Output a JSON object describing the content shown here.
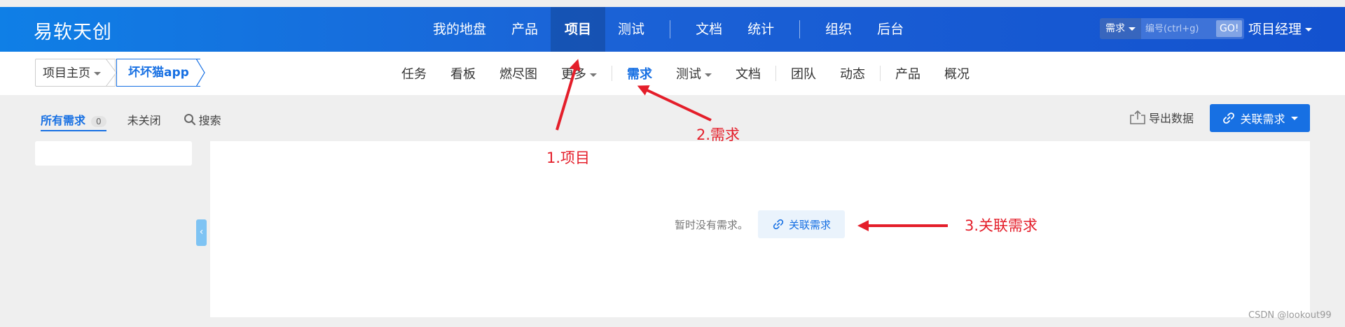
{
  "header": {
    "logo": "易软天创",
    "nav": [
      "我的地盘",
      "产品",
      "项目",
      "测试",
      "文档",
      "统计",
      "组织",
      "后台"
    ],
    "active_nav": "项目",
    "search": {
      "type": "需求",
      "placeholder": "编号(ctrl+g)",
      "go": "GO!"
    },
    "user_role": "项目经理"
  },
  "subbar": {
    "breadcrumb_home": "项目主页",
    "breadcrumb_project": "坏坏猫app",
    "nav": [
      "任务",
      "看板",
      "燃尽图",
      "更多",
      "需求",
      "测试",
      "文档",
      "团队",
      "动态",
      "产品",
      "概况"
    ],
    "active": "需求"
  },
  "content": {
    "tab_all": "所有需求",
    "tab_all_count": "0",
    "tab_unclosed": "未关闭",
    "search": "搜索",
    "export": "导出数据",
    "link_story": "关联需求",
    "empty_text": "暂时没有需求。",
    "empty_link": "关联需求"
  },
  "annotations": {
    "step1": "1.项目",
    "step2": "2.需求",
    "step3": "3.关联需求"
  },
  "watermark": "CSDN @lookout99",
  "colors": {
    "primary": "#1770e3",
    "header": "#1352cf",
    "annotation": "#e41e2a"
  }
}
